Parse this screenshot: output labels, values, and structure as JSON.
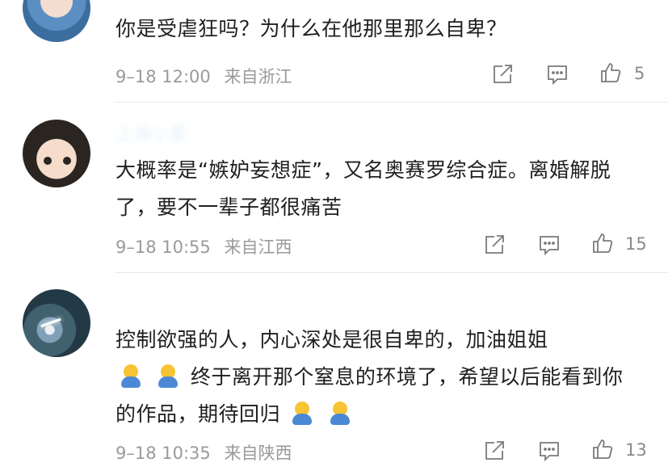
{
  "comments": [
    {
      "username": "",
      "text": "你是受虐狂吗？为什么在他那里那么自卑？",
      "time": "9–18 12:00",
      "location": "来自浙江",
      "likes": "5"
    },
    {
      "username": "上海小爱",
      "text": "大概率是“嫉妒妄想症”，又名奥赛罗综合症。离婚解脱了，要不一辈子都很痛苦",
      "time": "9–18 10:55",
      "location": "来自江西",
      "likes": "15"
    },
    {
      "username": "",
      "text_parts": [
        "控制欲强的人，内心深处是很自卑的，加油姐姐",
        "终于离开那个窒息的环境了，希望以后能看到你的作品，期待回归"
      ],
      "time": "9–18 10:35",
      "location": "来自陕西",
      "likes": "13"
    }
  ],
  "icons": {
    "share": "share-icon",
    "reply": "reply-icon",
    "like": "thumbs-up-icon"
  }
}
